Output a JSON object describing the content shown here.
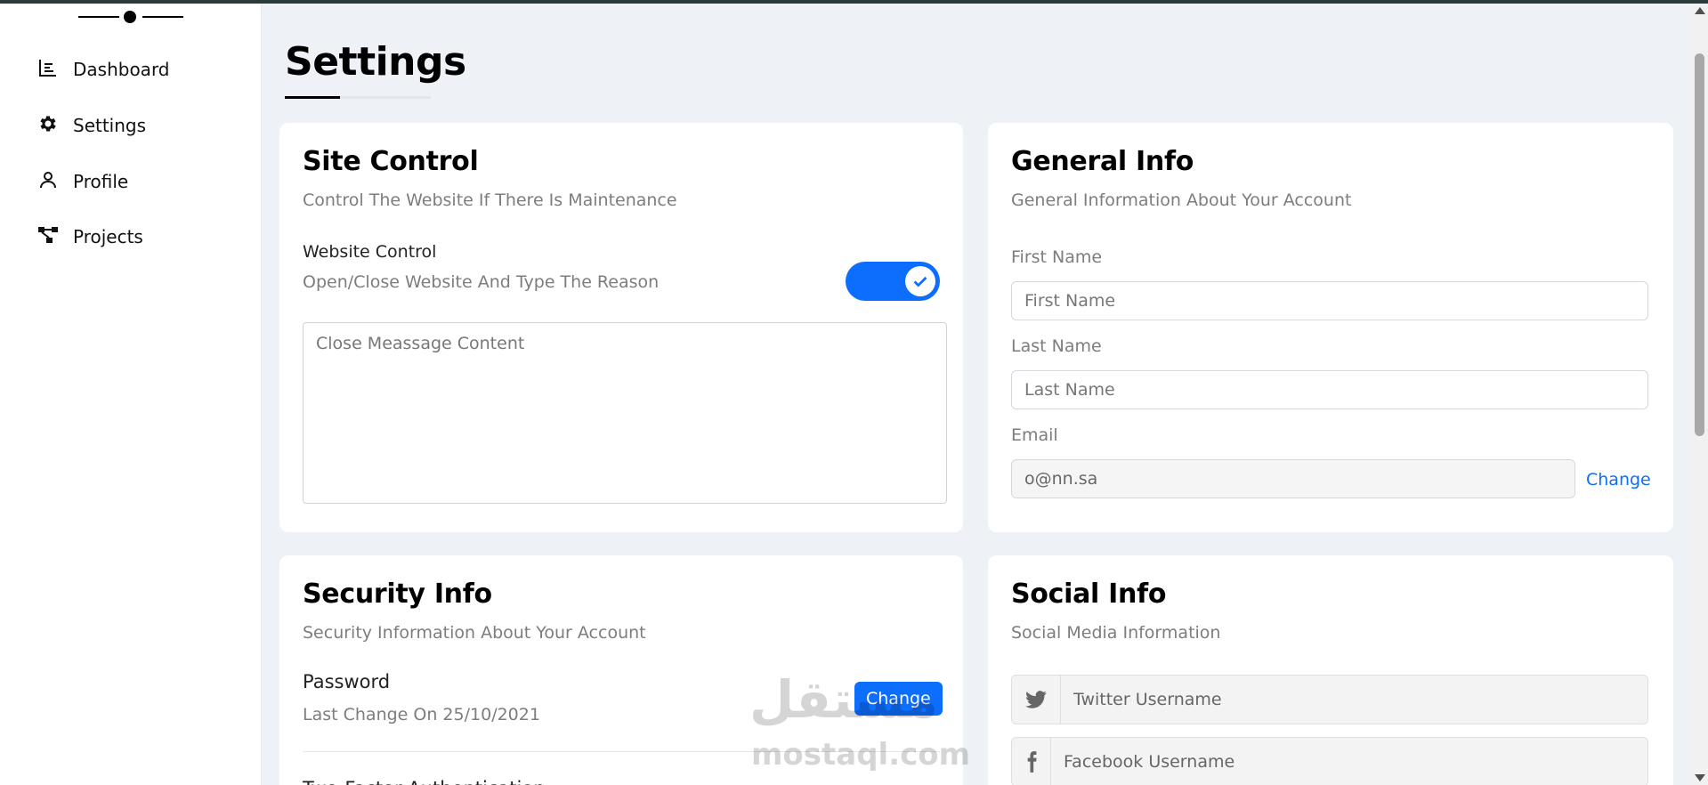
{
  "colors": {
    "accent": "#0d6efd",
    "sidebar_bg": "#ffffff",
    "main_bg": "#eef2f7"
  },
  "sidebar": {
    "items": [
      {
        "label": "Dashboard",
        "icon": "chart-icon"
      },
      {
        "label": "Settings",
        "icon": "gear-icon"
      },
      {
        "label": "Profile",
        "icon": "user-icon"
      },
      {
        "label": "Projects",
        "icon": "diagram-icon"
      }
    ]
  },
  "page": {
    "title": "Settings"
  },
  "site_control": {
    "title": "Site Control",
    "subtitle": "Control The Website If There Is Maintenance",
    "toggle_label": "Website Control",
    "toggle_desc": "Open/Close Website And Type The Reason",
    "toggle_on": true,
    "textarea_placeholder": "Close Meassage Content"
  },
  "general_info": {
    "title": "General Info",
    "subtitle": "General Information About Your Account",
    "first_name_label": "First Name",
    "first_name_placeholder": "First Name",
    "last_name_label": "Last Name",
    "last_name_placeholder": "Last Name",
    "email_label": "Email",
    "email_value": "o@nn.sa",
    "email_change": "Change"
  },
  "security_info": {
    "title": "Security Info",
    "subtitle": "Security Information About Your Account",
    "password_label": "Password",
    "password_desc": "Last Change On 25/10/2021",
    "change_button": "Change",
    "two_factor_label": "Two-Factor Authentication"
  },
  "social_info": {
    "title": "Social Info",
    "subtitle": "Social Media Information",
    "twitter_placeholder": "Twitter Username",
    "facebook_placeholder": "Facebook Username"
  },
  "watermark": {
    "arabic": "مستقل",
    "latin": "mostaql.com"
  }
}
